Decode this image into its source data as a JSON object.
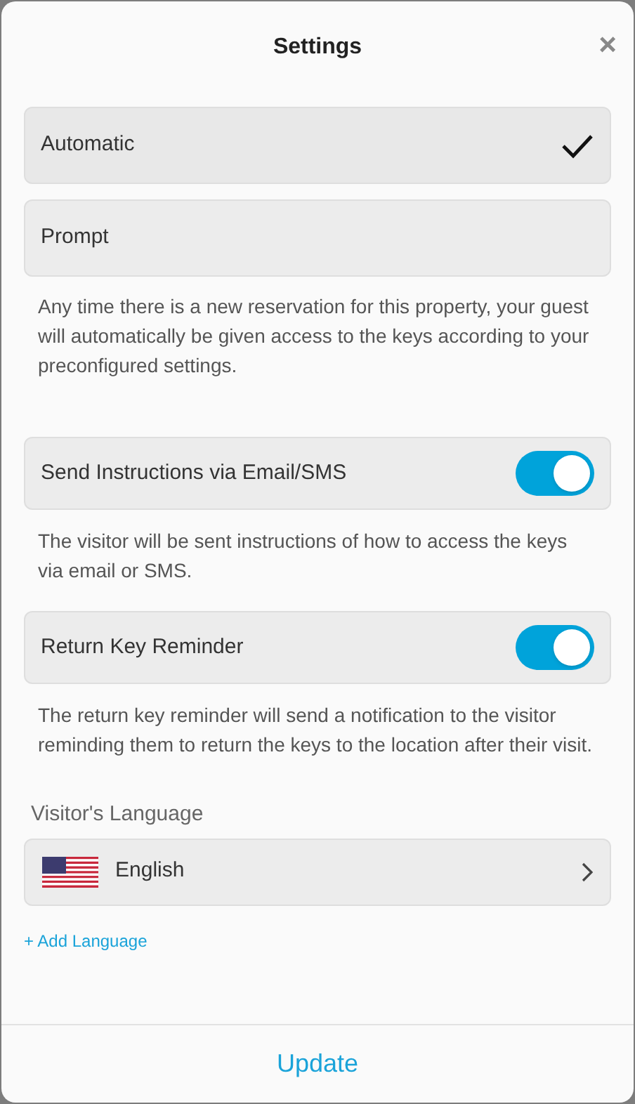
{
  "title": "Settings",
  "close": "×",
  "modes": [
    {
      "label": "Automatic",
      "selected": true
    },
    {
      "label": "Prompt",
      "selected": false
    }
  ],
  "mode_description": "Any time there is a new reservation for this property, your guest will automatically be given access to the keys according to your preconfigured settings.",
  "toggles": [
    {
      "label": "Send Instructions via Email/SMS",
      "on": true,
      "description": "The visitor will be sent instructions of how to access the keys via email or SMS."
    },
    {
      "label": "Return Key Reminder",
      "on": true,
      "description": "The return key reminder will send a notification to the visitor reminding them to return the keys to the location after their visit."
    }
  ],
  "language": {
    "label": "Visitor's Language",
    "value": "English",
    "add_link": "+ Add Language"
  },
  "footer_button": "Update"
}
